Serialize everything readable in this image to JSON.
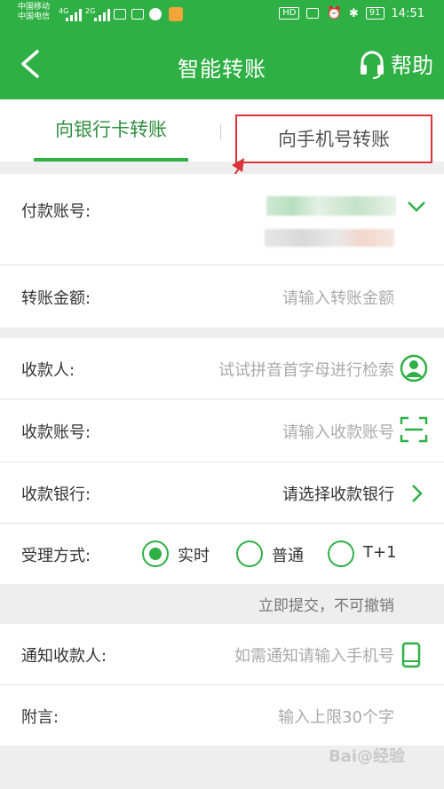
{
  "status_bar": {
    "carrier1": "中国移动",
    "carrier2": "中国电信",
    "net1": "4G",
    "net2": "2G",
    "hd": "HD",
    "battery": "91",
    "time": "14:51"
  },
  "nav": {
    "title": "智能转账",
    "help": "帮助"
  },
  "tabs": {
    "bank_card": "向银行卡转账",
    "phone": "向手机号转账"
  },
  "form": {
    "payer_label": "付款账号:",
    "amount_label": "转账金额:",
    "amount_placeholder": "请输入转账金额",
    "payee_label": "收款人:",
    "payee_placeholder": "试试拼音首字母进行检索",
    "account_label": "收款账号:",
    "account_placeholder": "请输入收款账号",
    "bank_label": "收款银行:",
    "bank_value": "请选择收款银行",
    "method_label": "受理方式:",
    "method_options": [
      "实时",
      "普通",
      "T+1"
    ],
    "method_selected": "实时",
    "method_hint": "立即提交，不可撤销",
    "notify_label": "通知收款人:",
    "notify_placeholder": "如需通知请输入手机号",
    "memo_label": "附言:",
    "memo_placeholder": "输入上限30个字"
  },
  "colors": {
    "brand_green": "#2fb044",
    "highlight_red": "#d7353a"
  }
}
